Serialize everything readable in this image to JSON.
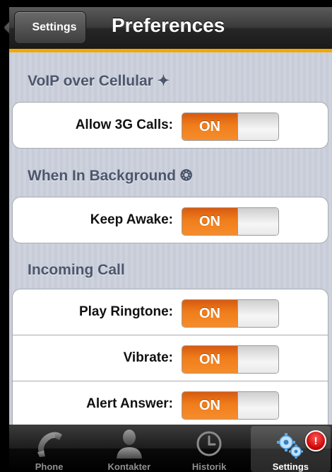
{
  "navbar": {
    "back_label": "Settings",
    "title": "Preferences"
  },
  "sections": [
    {
      "title": "VoIP over Cellular ✦",
      "rows": [
        {
          "label": "Allow 3G Calls:",
          "toggle": "ON"
        }
      ]
    },
    {
      "title": "When In Background ❂",
      "rows": [
        {
          "label": "Keep Awake:",
          "toggle": "ON"
        }
      ]
    },
    {
      "title": "Incoming Call",
      "rows": [
        {
          "label": "Play Ringtone:",
          "toggle": "ON"
        },
        {
          "label": "Vibrate:",
          "toggle": "ON"
        },
        {
          "label": "Alert Answer:",
          "toggle": "ON"
        }
      ]
    }
  ],
  "tabbar": {
    "tabs": [
      {
        "label": "Phone",
        "icon": "phone-icon"
      },
      {
        "label": "Kontakter",
        "icon": "contact-icon"
      },
      {
        "label": "Historik",
        "icon": "clock-icon"
      },
      {
        "label": "Settings",
        "icon": "gears-icon",
        "badge": "!"
      }
    ],
    "active": "Settings"
  },
  "colors": {
    "accent": "#f0a800",
    "toggle_on": "#f07d1b",
    "section_text": "#4c566c"
  }
}
